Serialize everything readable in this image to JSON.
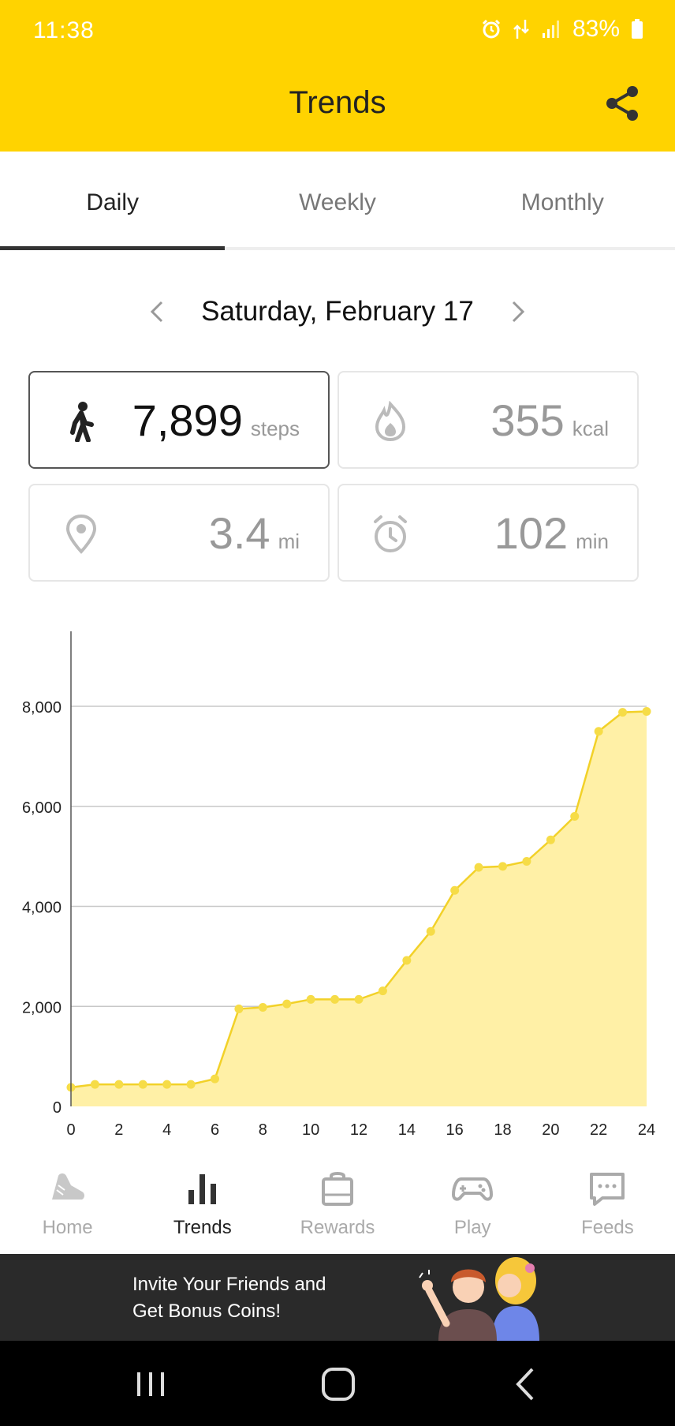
{
  "status": {
    "time": "11:38",
    "battery": "83%"
  },
  "header": {
    "title": "Trends"
  },
  "tabs": [
    {
      "label": "Daily",
      "active": true
    },
    {
      "label": "Weekly",
      "active": false
    },
    {
      "label": "Monthly",
      "active": false
    }
  ],
  "date": {
    "label": "Saturday, February 17"
  },
  "stats": {
    "steps": {
      "value": "7,899",
      "unit": "steps",
      "icon": "walking-icon"
    },
    "calories": {
      "value": "355",
      "unit": "kcal",
      "icon": "flame-icon"
    },
    "distance": {
      "value": "3.4",
      "unit": "mi",
      "icon": "location-pin-icon"
    },
    "time": {
      "value": "102",
      "unit": "min",
      "icon": "alarm-clock-icon"
    }
  },
  "chart_data": {
    "type": "area",
    "x": [
      0,
      1,
      2,
      3,
      4,
      5,
      6,
      7,
      8,
      9,
      10,
      11,
      12,
      13,
      14,
      15,
      16,
      17,
      18,
      19,
      20,
      21,
      22,
      23,
      24
    ],
    "values": [
      380,
      440,
      440,
      440,
      440,
      440,
      550,
      1950,
      1980,
      2050,
      2140,
      2140,
      2140,
      2310,
      2920,
      3500,
      4320,
      4780,
      4800,
      4900,
      5330,
      5800,
      7500,
      7880,
      7899
    ],
    "xticks": [
      "0",
      "2",
      "4",
      "6",
      "8",
      "10",
      "12",
      "14",
      "16",
      "18",
      "20",
      "22",
      "24"
    ],
    "yticks": [
      "0",
      "2,000",
      "4,000",
      "6,000",
      "8,000"
    ],
    "xlim": [
      0,
      24
    ],
    "ylim": [
      0,
      9500
    ],
    "grid": true,
    "colors": {
      "line": "#F2D128",
      "fill": "#FFF0A6",
      "point": "#F6DC47",
      "grid": "#c8c8c8"
    }
  },
  "bottom_nav": [
    {
      "label": "Home",
      "icon": "shoe-icon",
      "active": false
    },
    {
      "label": "Trends",
      "icon": "bar-chart-icon",
      "active": true
    },
    {
      "label": "Rewards",
      "icon": "shopping-bag-icon",
      "active": false
    },
    {
      "label": "Play",
      "icon": "gamepad-icon",
      "active": false
    },
    {
      "label": "Feeds",
      "icon": "chat-bubble-icon",
      "active": false
    }
  ],
  "banner": {
    "line1": "Invite Your Friends and",
    "line2": "Get Bonus Coins!"
  },
  "colors": {
    "brand": "#FFD300",
    "banner_bg": "#2a2a2a"
  }
}
